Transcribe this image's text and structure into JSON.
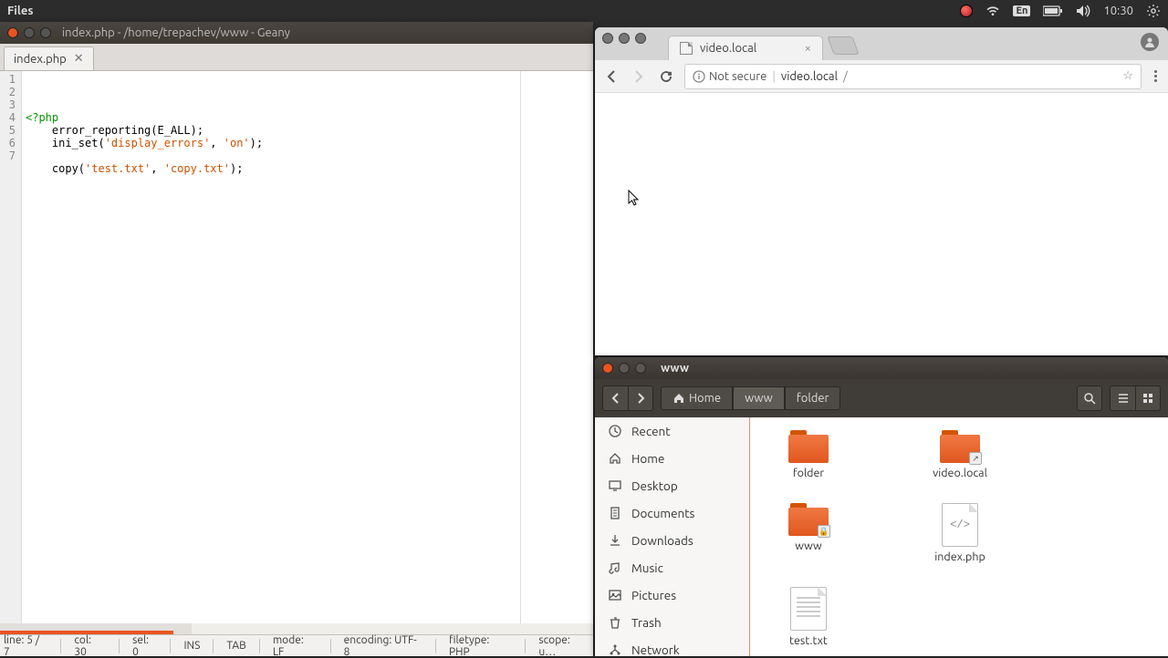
{
  "top_panel": {
    "app_title": "Files",
    "lang": "En",
    "time": "10:30"
  },
  "geany": {
    "window_title": "index.php - /home/trepachev/www - Geany",
    "tab_name": "index.php",
    "code_lines": [
      {
        "n": "1",
        "pre": "",
        "tag": "<?php",
        "post": ""
      },
      {
        "n": "2",
        "pre": "    error_reporting(E_ALL);",
        "tag": "",
        "post": ""
      },
      {
        "n": "3",
        "pre": "    ini_set(",
        "s1": "'display_errors'",
        "mid": ", ",
        "s2": "'on'",
        "post": ");"
      },
      {
        "n": "4",
        "pre": "",
        "tag": "",
        "post": ""
      },
      {
        "n": "5",
        "pre": "    copy(",
        "s1": "'test.txt'",
        "mid": ", ",
        "s2": "'copy.txt'",
        "post": ");"
      },
      {
        "n": "6",
        "pre": "",
        "tag": "",
        "post": ""
      },
      {
        "n": "7",
        "pre": "",
        "tag": "",
        "post": ""
      }
    ],
    "status": {
      "line": "line: 5 / 7",
      "col": "col: 30",
      "sel": "sel: 0",
      "ins": "INS",
      "tab": "TAB",
      "mode": "mode: LF",
      "encoding": "encoding: UTF-8",
      "filetype": "filetype: PHP",
      "scope": "scope: u…"
    }
  },
  "chrome": {
    "tab_title": "video.local",
    "not_secure": "Not secure",
    "url_host": "video.local",
    "url_path": "/"
  },
  "nautilus": {
    "window_title": "www",
    "breadcrumbs": [
      "Home",
      "www",
      "folder"
    ],
    "sidebar": [
      {
        "icon": "recent",
        "label": "Recent"
      },
      {
        "icon": "home",
        "label": "Home"
      },
      {
        "icon": "desktop",
        "label": "Desktop"
      },
      {
        "icon": "documents",
        "label": "Documents"
      },
      {
        "icon": "downloads",
        "label": "Downloads"
      },
      {
        "icon": "music",
        "label": "Music"
      },
      {
        "icon": "pictures",
        "label": "Pictures"
      },
      {
        "icon": "trash",
        "label": "Trash"
      },
      {
        "icon": "network",
        "label": "Network"
      }
    ],
    "items": [
      {
        "type": "folder",
        "label": "folder"
      },
      {
        "type": "folder-link",
        "label": "video.local"
      },
      {
        "type": "folder-lock",
        "label": "www"
      },
      {
        "type": "code",
        "label": "index.php"
      },
      {
        "type": "text",
        "label": "test.txt"
      }
    ]
  }
}
